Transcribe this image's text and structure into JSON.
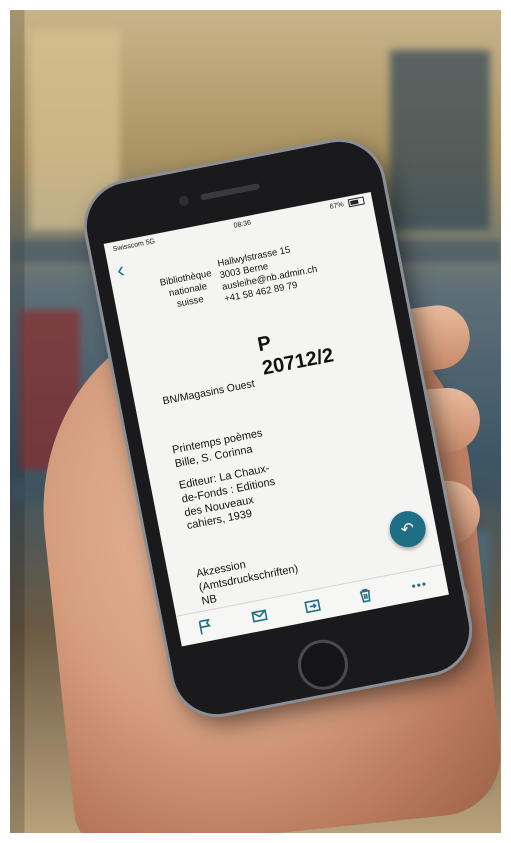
{
  "status_bar": {
    "carrier": "Swisscom",
    "network": "5G",
    "time": "08:36",
    "battery": "67%"
  },
  "library": {
    "name_line1": "Bibliothèque",
    "name_line2": "nationale",
    "name_line3": "suisse",
    "street": "Hallwylstrasse 15",
    "city": "3003 Berne",
    "email": "ausleihe@nb.admin.ch",
    "phone": "+41 58 462 89 79"
  },
  "shelfmark": {
    "location": "BN/Magasins Ouest",
    "prefix": "P",
    "number": "20712/2"
  },
  "book": {
    "title": "Printemps poèmes",
    "author": "Bille, S. Corinna",
    "publisher_line1": "Editeur: La Chaux-",
    "publisher_line2": "de-Fonds : Editions",
    "publisher_line3": "des Nouveaux",
    "publisher_line4": "cahiers, 1939"
  },
  "accession": {
    "line1": "Akzession",
    "line2": "(Amtsdruckschriften)",
    "line3": "NB"
  },
  "icons": {
    "back": "chevron-left-icon",
    "reply": "reply-icon",
    "flag": "flag-icon",
    "mail": "mail-icon",
    "move": "move-to-folder-icon",
    "trash": "trash-icon",
    "more": "more-icon"
  },
  "colors": {
    "accent": "#1e6f86"
  }
}
